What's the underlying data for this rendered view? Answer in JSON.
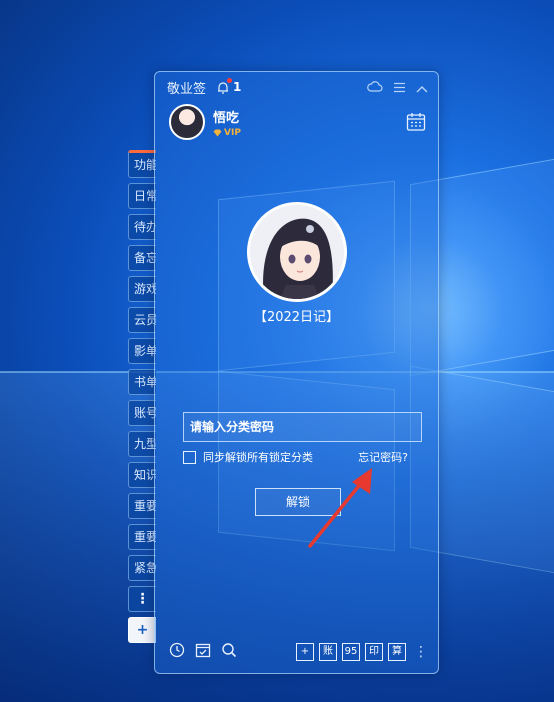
{
  "titlebar": {
    "app_title": "敬业签",
    "notification_count": "1"
  },
  "user": {
    "name": "悟吃",
    "badge": "VIP"
  },
  "category_name": "【2022日记】",
  "password": {
    "placeholder": "请输入分类密码",
    "value": ""
  },
  "sync_label": "同步解锁所有锁定分类",
  "forgot_label": "忘记密码?",
  "unlock_label": "解锁",
  "side_tabs": [
    {
      "label": "功能"
    },
    {
      "label": "日常"
    },
    {
      "label": "待办"
    },
    {
      "label": "备忘"
    },
    {
      "label": "游戏"
    },
    {
      "label": "云员"
    },
    {
      "label": "影单"
    },
    {
      "label": "书单"
    },
    {
      "label": "账号"
    },
    {
      "label": "九型"
    },
    {
      "label": "知识"
    },
    {
      "label": "重要"
    },
    {
      "label": "重要"
    },
    {
      "label": "紧急"
    }
  ],
  "side_more_icon": "⋮",
  "side_add_icon": "+",
  "bottom_tools": [
    "+",
    "账",
    "95",
    "印",
    "算"
  ],
  "bottom_more_icon": "⋮",
  "colors": {
    "vip": "#f4b23a",
    "notification_dot": "#ff3b3b",
    "arrow": "#e8392e"
  }
}
